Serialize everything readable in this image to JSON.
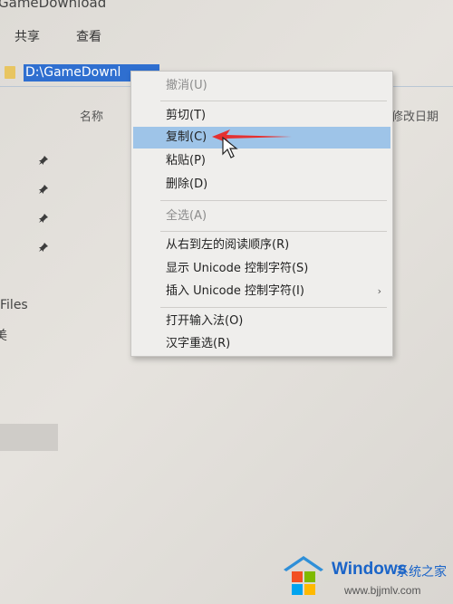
{
  "window": {
    "title": "GameDownload"
  },
  "ribbon": {
    "tabs": [
      "共享",
      "查看"
    ]
  },
  "address_bar": {
    "path": "D:\\GameDownl"
  },
  "columns": {
    "name": "名称",
    "modified": "修改日期"
  },
  "sidebar": {
    "files_label": "Files",
    "partial_label": "美"
  },
  "context_menu": {
    "items": [
      {
        "label": "撤消(U)",
        "state": "disabled"
      },
      {
        "label": "剪切(T)",
        "state": "enabled"
      },
      {
        "label": "复制(C)",
        "state": "highlighted"
      },
      {
        "label": "粘贴(P)",
        "state": "enabled"
      },
      {
        "label": "删除(D)",
        "state": "enabled"
      },
      {
        "label": "全选(A)",
        "state": "disabled"
      },
      {
        "label": "从右到左的阅读顺序(R)",
        "state": "enabled"
      },
      {
        "label": "显示 Unicode 控制字符(S)",
        "state": "enabled"
      },
      {
        "label": "插入 Unicode 控制字符(I)",
        "state": "enabled",
        "submenu": true
      },
      {
        "label": "打开输入法(O)",
        "state": "enabled"
      },
      {
        "label": "汉字重选(R)",
        "state": "enabled"
      }
    ]
  },
  "watermark": {
    "name": "Windows",
    "cn": "系统之家",
    "url": "www.bjjmlv.com"
  },
  "colors": {
    "selection": "#2f6fd0",
    "menu_highlight": "#9ec4e8",
    "annotation": "#e53030",
    "brand": "#1a64c8"
  },
  "icons": [
    "folder-icon",
    "pin-icon",
    "chevron-right-icon",
    "mouse-cursor-icon",
    "red-arrow-annotation"
  ]
}
